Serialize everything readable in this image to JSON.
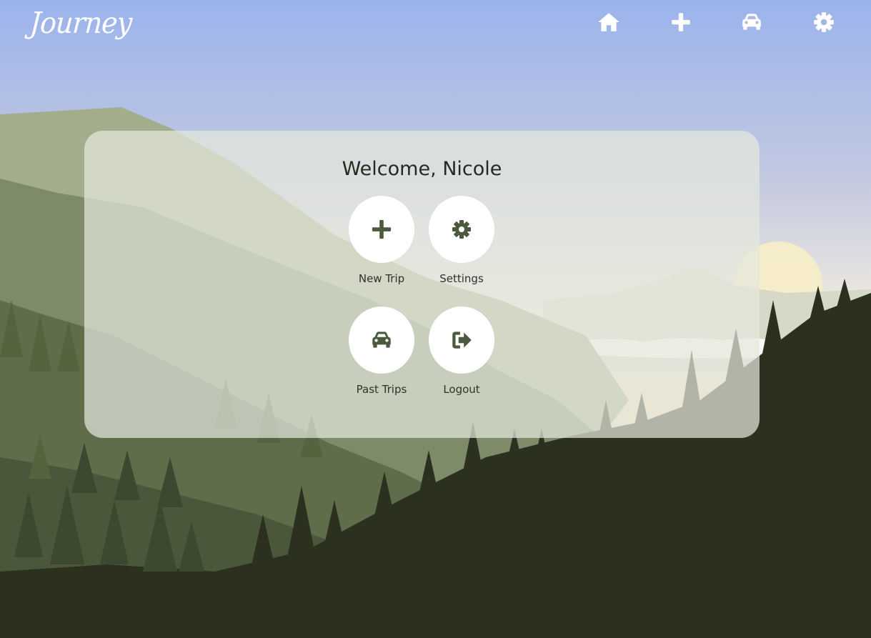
{
  "app": {
    "logo": "Journey"
  },
  "nav": [
    {
      "name": "home",
      "icon": "home-icon"
    },
    {
      "name": "new-trip",
      "icon": "plus-icon"
    },
    {
      "name": "past-trips",
      "icon": "car-icon"
    },
    {
      "name": "settings",
      "icon": "gear-icon"
    }
  ],
  "main": {
    "welcome": "Welcome, Nicole",
    "actions": {
      "new_trip": {
        "label": "New Trip",
        "icon": "plus-icon"
      },
      "settings": {
        "label": "Settings",
        "icon": "gear-icon"
      },
      "past_trips": {
        "label": "Past Trips",
        "icon": "car-icon"
      },
      "logout": {
        "label": "Logout",
        "icon": "logout-icon"
      }
    }
  },
  "colors": {
    "icon_green": "#4b5a3c",
    "dark_forest": "#2b311e",
    "sky_top": "#9db4ec"
  }
}
